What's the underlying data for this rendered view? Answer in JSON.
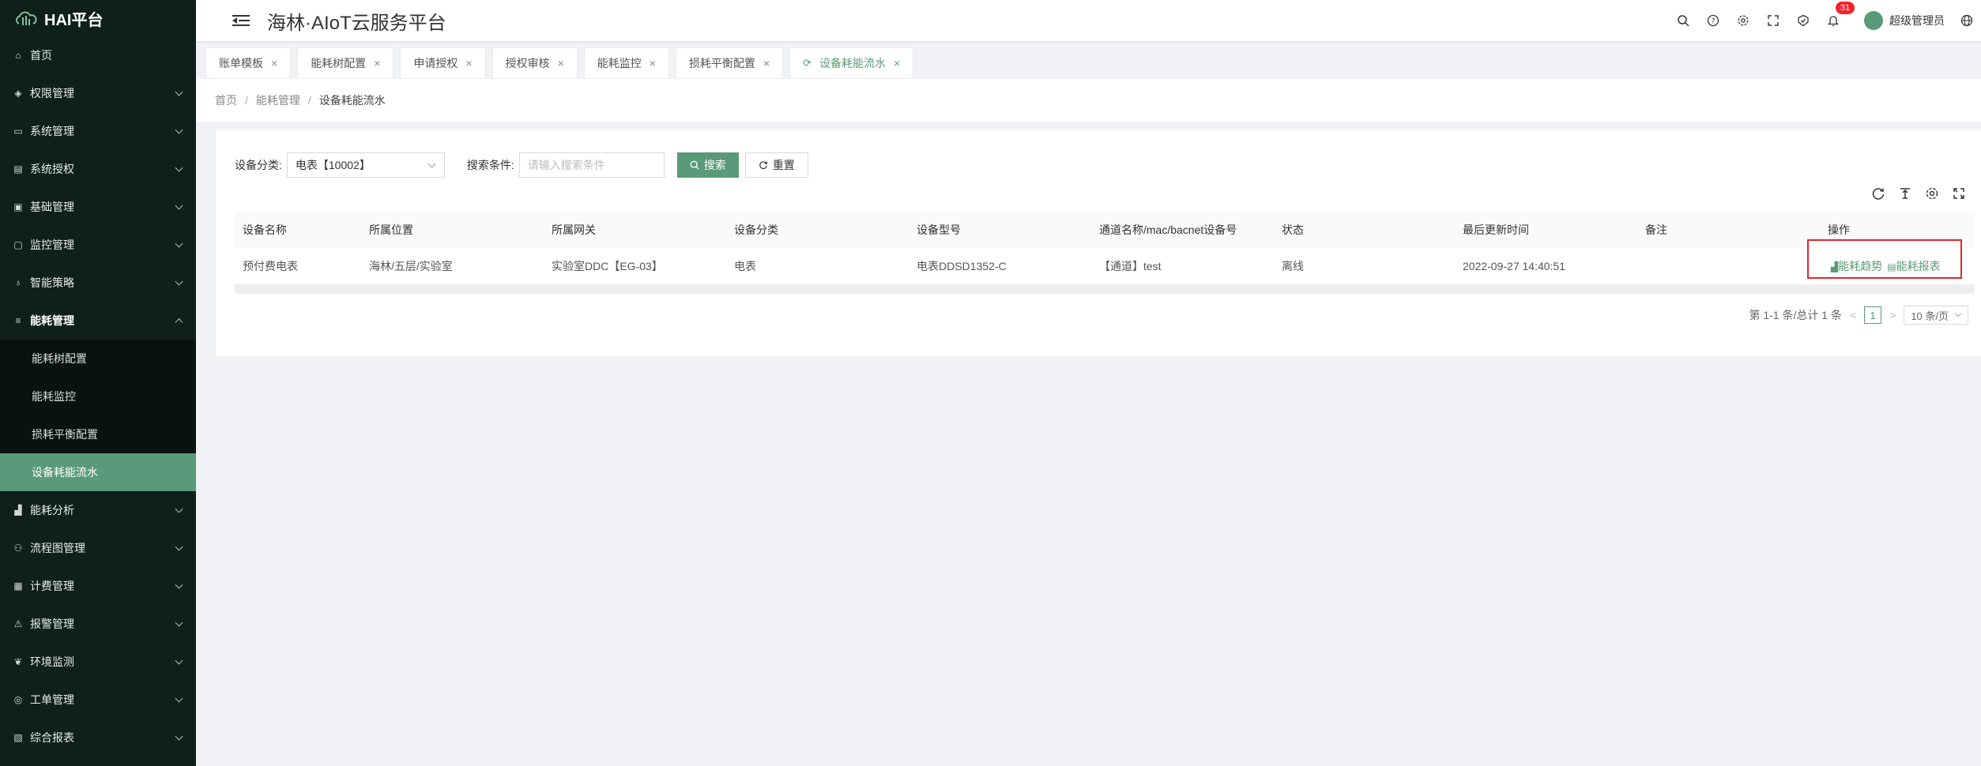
{
  "brand": {
    "logo_text": "HAI平台"
  },
  "header": {
    "title": "海林·AIoT云服务平台",
    "notifications": "31",
    "user": "超级管理员"
  },
  "sidebar": {
    "items": [
      {
        "label": "首页",
        "icon": "home-icon",
        "chevron": false
      },
      {
        "label": "权限管理",
        "icon": "shield-icon",
        "chevron": true
      },
      {
        "label": "系统管理",
        "icon": "monitor-icon",
        "chevron": true
      },
      {
        "label": "系统授权",
        "icon": "doc-icon",
        "chevron": true
      },
      {
        "label": "基础管理",
        "icon": "card-icon",
        "chevron": true
      },
      {
        "label": "监控管理",
        "icon": "screen-icon",
        "chevron": true
      },
      {
        "label": "智能策略",
        "icon": "bulb-icon",
        "chevron": true
      },
      {
        "label": "能耗管理",
        "icon": "sliders-icon",
        "chevron": true,
        "open": true
      }
    ],
    "sub_items": [
      {
        "label": "能耗树配置"
      },
      {
        "label": "能耗监控"
      },
      {
        "label": "损耗平衡配置"
      },
      {
        "label": "设备耗能流水",
        "active": true
      }
    ],
    "items_after": [
      {
        "label": "能耗分析",
        "icon": "chart-icon"
      },
      {
        "label": "流程图管理",
        "icon": "flow-icon"
      },
      {
        "label": "计费管理",
        "icon": "wallet-icon"
      },
      {
        "label": "报警管理",
        "icon": "alarm-icon"
      },
      {
        "label": "环境监测",
        "icon": "leaf-icon"
      },
      {
        "label": "工单管理",
        "icon": "order-icon"
      },
      {
        "label": "综合报表",
        "icon": "report-icon"
      }
    ]
  },
  "tabs": [
    {
      "label": "账单模板"
    },
    {
      "label": "能耗树配置"
    },
    {
      "label": "申请授权"
    },
    {
      "label": "授权审核"
    },
    {
      "label": "能耗监控"
    },
    {
      "label": "损耗平衡配置"
    },
    {
      "label": "设备耗能流水",
      "active": true
    }
  ],
  "breadcrumb": {
    "home": "首页",
    "parent": "能耗管理",
    "current": "设备耗能流水"
  },
  "filter": {
    "category_label": "设备分类:",
    "category_value": "电表【10002】",
    "search_label": "搜索条件:",
    "search_placeholder": "请输入搜索条件",
    "search_btn": "搜索",
    "reset_btn": "重置"
  },
  "table": {
    "columns": [
      "设备名称",
      "所属位置",
      "所属网关",
      "设备分类",
      "设备型号",
      "通道名称/mac/bacnet设备号",
      "状态",
      "最后更新时间",
      "备注",
      "操作"
    ],
    "rows": [
      {
        "name": "预付费电表",
        "location": "海林/五层/实验室",
        "gateway": "实验室DDC【EG-03】",
        "category": "电表",
        "model": "电表DDSD1352-C",
        "channel": "【通道】test",
        "status": "离线",
        "updated": "2022-09-27 14:40:51",
        "remark": "",
        "op1": "能耗趋势",
        "op2": "能耗报表"
      }
    ]
  },
  "pager": {
    "summary": "第 1-1 条/总计 1 条",
    "page": "1",
    "size": "10 条/页"
  },
  "colors": {
    "accent": "#5a9a78",
    "sidebar": "#0f1f1a",
    "highlight": "#e0262b"
  }
}
